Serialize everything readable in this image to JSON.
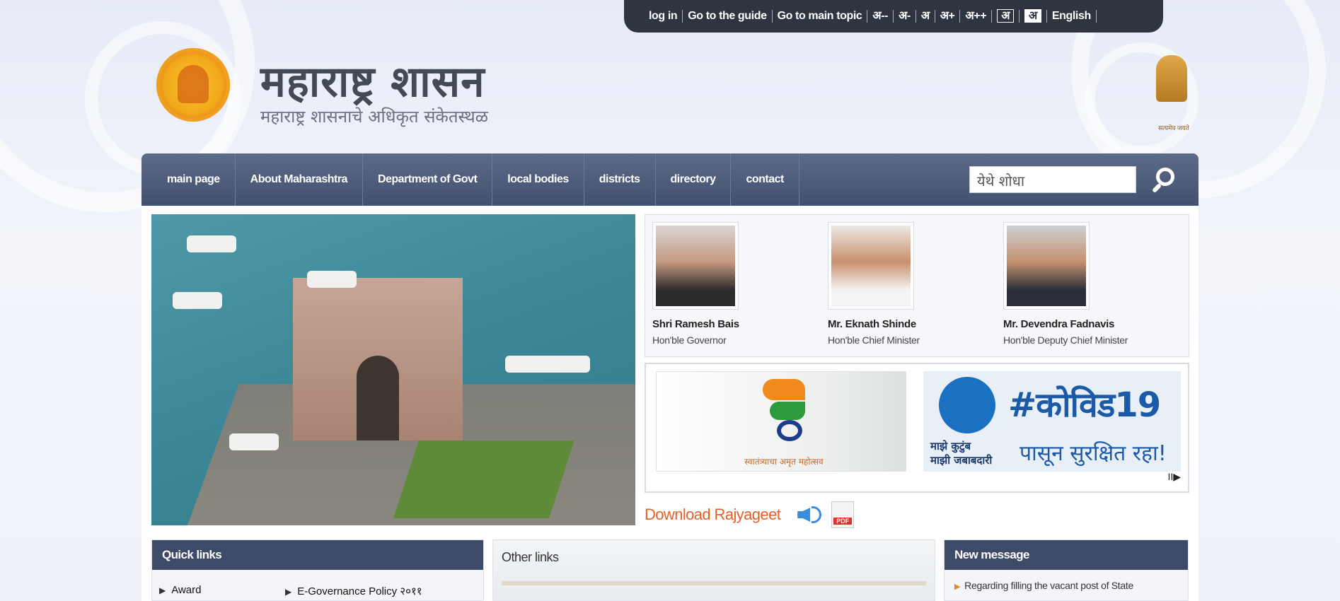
{
  "topbar": {
    "items": [
      "log in",
      "Go to the guide",
      "Go to main topic",
      "अ--",
      "अ-",
      "अ",
      "अ+",
      "अ++",
      "अ",
      "अ",
      "English"
    ]
  },
  "header": {
    "title": "महाराष्ट्र शासन",
    "subtitle": "महाराष्ट्र शासनाचे अधिकृत संकेतस्थळ",
    "emblem_motto": "सत्यमेव जयते"
  },
  "nav": {
    "items": [
      "main page",
      "About Maharashtra",
      "Department of Govt",
      "local bodies",
      "districts",
      "directory",
      "contact"
    ],
    "search_placeholder": "येथे शोधा"
  },
  "leaders": [
    {
      "name": "Shri Ramesh Bais",
      "role": "Hon'ble Governor"
    },
    {
      "name": "Mr. Eknath Shinde",
      "role": "Hon'ble Chief Minister"
    },
    {
      "name": "Mr. Devendra Fadnavis",
      "role": "Hon'ble Deputy Chief Minister"
    }
  ],
  "banners": {
    "amrit_caption": "स्वातंत्र्याचा अमृत महोत्सव",
    "covid_tag": "#कोविड19",
    "covid_line1": "माझे कुटुंब",
    "covid_line2": "माझी जबाबदारी",
    "covid_line3": "पासून सुरक्षित रहा!",
    "control": "II▶"
  },
  "rajyageet": {
    "label": "Download Rajyageet",
    "pdf": "PDF"
  },
  "quick_links": {
    "title": "Quick links",
    "items": [
      "Award",
      "E-Governance Policy २०११"
    ]
  },
  "other_links": {
    "title": "Other links"
  },
  "new_message": {
    "title": "New message",
    "items": [
      "Regarding filling the vacant post of State"
    ]
  },
  "colors": {
    "nav": "#45536f",
    "accent": "#e0612a",
    "topbar": "#2f3540"
  }
}
